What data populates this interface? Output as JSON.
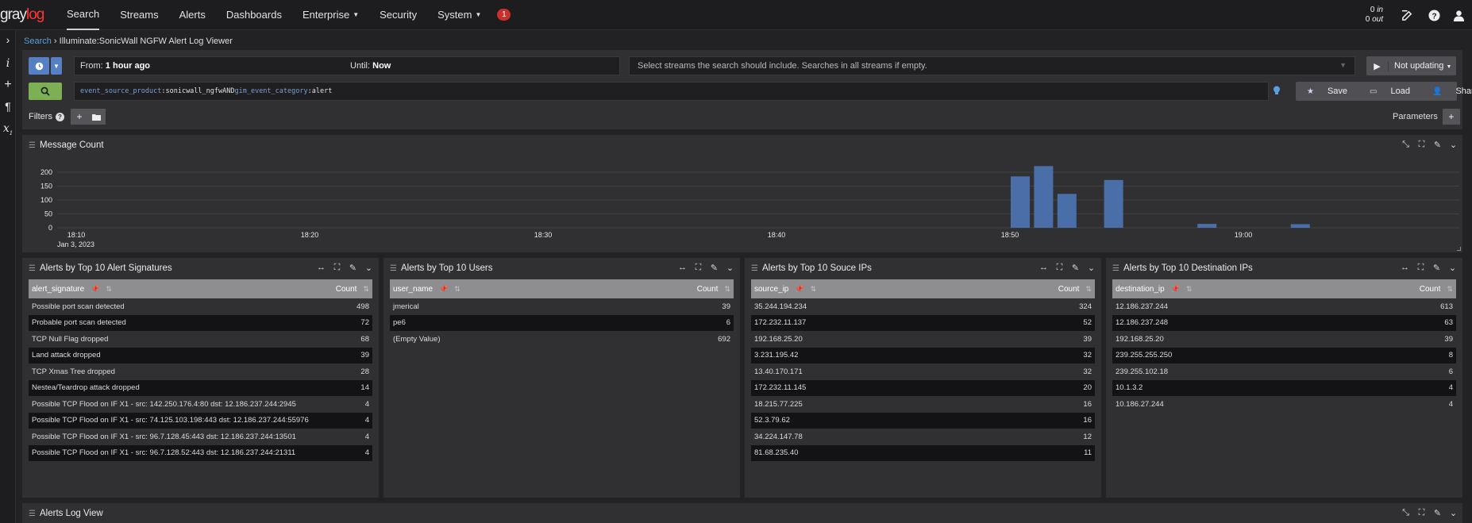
{
  "nav": {
    "logo_a": "gray",
    "logo_b": "log",
    "items": [
      "Search",
      "Streams",
      "Alerts",
      "Dashboards",
      "Enterprise",
      "Security",
      "System"
    ],
    "badge": "1",
    "throughput_in": "0",
    "throughput_in_unit": "in",
    "throughput_out": "0",
    "throughput_out_unit": "out"
  },
  "breadcrumb": {
    "root": "Search",
    "page": "Illuminate:SonicWall NGFW Alert Log Viewer"
  },
  "query": {
    "from_label": "From:",
    "from_value": "1 hour ago",
    "until_label": "Until:",
    "until_value": "Now",
    "streams_placeholder": "Select streams the search should include. Searches in all streams if empty.",
    "refresh_label": "Not updating",
    "q_k1": "event_source_product",
    "q_v1": ":sonicwall_ngfw ",
    "q_and": "AND ",
    "q_k2": "gim_event_category",
    "q_v2": ":alert",
    "save": "Save",
    "load": "Load",
    "share": "Share",
    "filters_label": "Filters",
    "parameters_label": "Parameters"
  },
  "message_count": {
    "title": "Message Count"
  },
  "chart_data": {
    "type": "bar",
    "title": "Message Count",
    "y_ticks": [
      0,
      50,
      100,
      150,
      200
    ],
    "ylim": [
      0,
      220
    ],
    "x_ticks": [
      "18:10",
      "18:20",
      "18:30",
      "18:40",
      "18:50",
      "19:00"
    ],
    "x_date": "Jan 3, 2023",
    "bars": [
      {
        "time": "18:50",
        "value": 185
      },
      {
        "time": "18:51",
        "value": 222
      },
      {
        "time": "18:52",
        "value": 122
      },
      {
        "time": "18:54",
        "value": 172
      },
      {
        "time": "18:58",
        "value": 14
      },
      {
        "time": "19:02",
        "value": 13
      }
    ]
  },
  "widgets": [
    {
      "title": "Alerts by Top 10 Alert Signatures",
      "col1": "alert_signature",
      "col2": "Count",
      "rows": [
        [
          "Possible port scan detected",
          "498"
        ],
        [
          "Probable port scan detected",
          "72"
        ],
        [
          "TCP Null Flag dropped",
          "68"
        ],
        [
          "Land attack dropped",
          "39"
        ],
        [
          "TCP Xmas Tree dropped",
          "28"
        ],
        [
          "Nestea/Teardrop attack dropped",
          "14"
        ],
        [
          "Possible TCP Flood on IF X1 - src: 142.250.176.4:80 dst: 12.186.237.244:2945",
          "4"
        ],
        [
          "Possible TCP Flood on IF X1 - src: 74.125.103.198:443 dst: 12.186.237.244:55976",
          "4"
        ],
        [
          "Possible TCP Flood on IF X1 - src: 96.7.128.45:443 dst: 12.186.237.244:13501",
          "4"
        ],
        [
          "Possible TCP Flood on IF X1 - src: 96.7.128.52:443 dst: 12.186.237.244:21311",
          "4"
        ]
      ]
    },
    {
      "title": "Alerts by Top 10 Users",
      "col1": "user_name",
      "col2": "Count",
      "rows": [
        [
          "jmerical",
          "39"
        ],
        [
          "pe6",
          "6"
        ],
        [
          "(Empty Value)",
          "692"
        ]
      ]
    },
    {
      "title": "Alerts by Top 10 Souce IPs",
      "col1": "source_ip",
      "col2": "Count",
      "rows": [
        [
          "35.244.194.234",
          "324"
        ],
        [
          "172.232.11.137",
          "52"
        ],
        [
          "192.168.25.20",
          "39"
        ],
        [
          "3.231.195.42",
          "32"
        ],
        [
          "13.40.170.171",
          "32"
        ],
        [
          "172.232.11.145",
          "20"
        ],
        [
          "18.215.77.225",
          "16"
        ],
        [
          "52.3.79.62",
          "16"
        ],
        [
          "34.224.147.78",
          "12"
        ],
        [
          "81.68.235.40",
          "11"
        ]
      ]
    },
    {
      "title": "Alerts by Top 10 Destination IPs",
      "col1": "destination_ip",
      "col2": "Count",
      "rows": [
        [
          "12.186.237.244",
          "613"
        ],
        [
          "12.186.237.248",
          "63"
        ],
        [
          "192.168.25.20",
          "39"
        ],
        [
          "239.255.255.250",
          "8"
        ],
        [
          "239.255.102.18",
          "6"
        ],
        [
          "10.1.3.2",
          "4"
        ],
        [
          "10.186.27.244",
          "4"
        ]
      ]
    }
  ],
  "log_view": {
    "title": "Alerts Log View"
  }
}
